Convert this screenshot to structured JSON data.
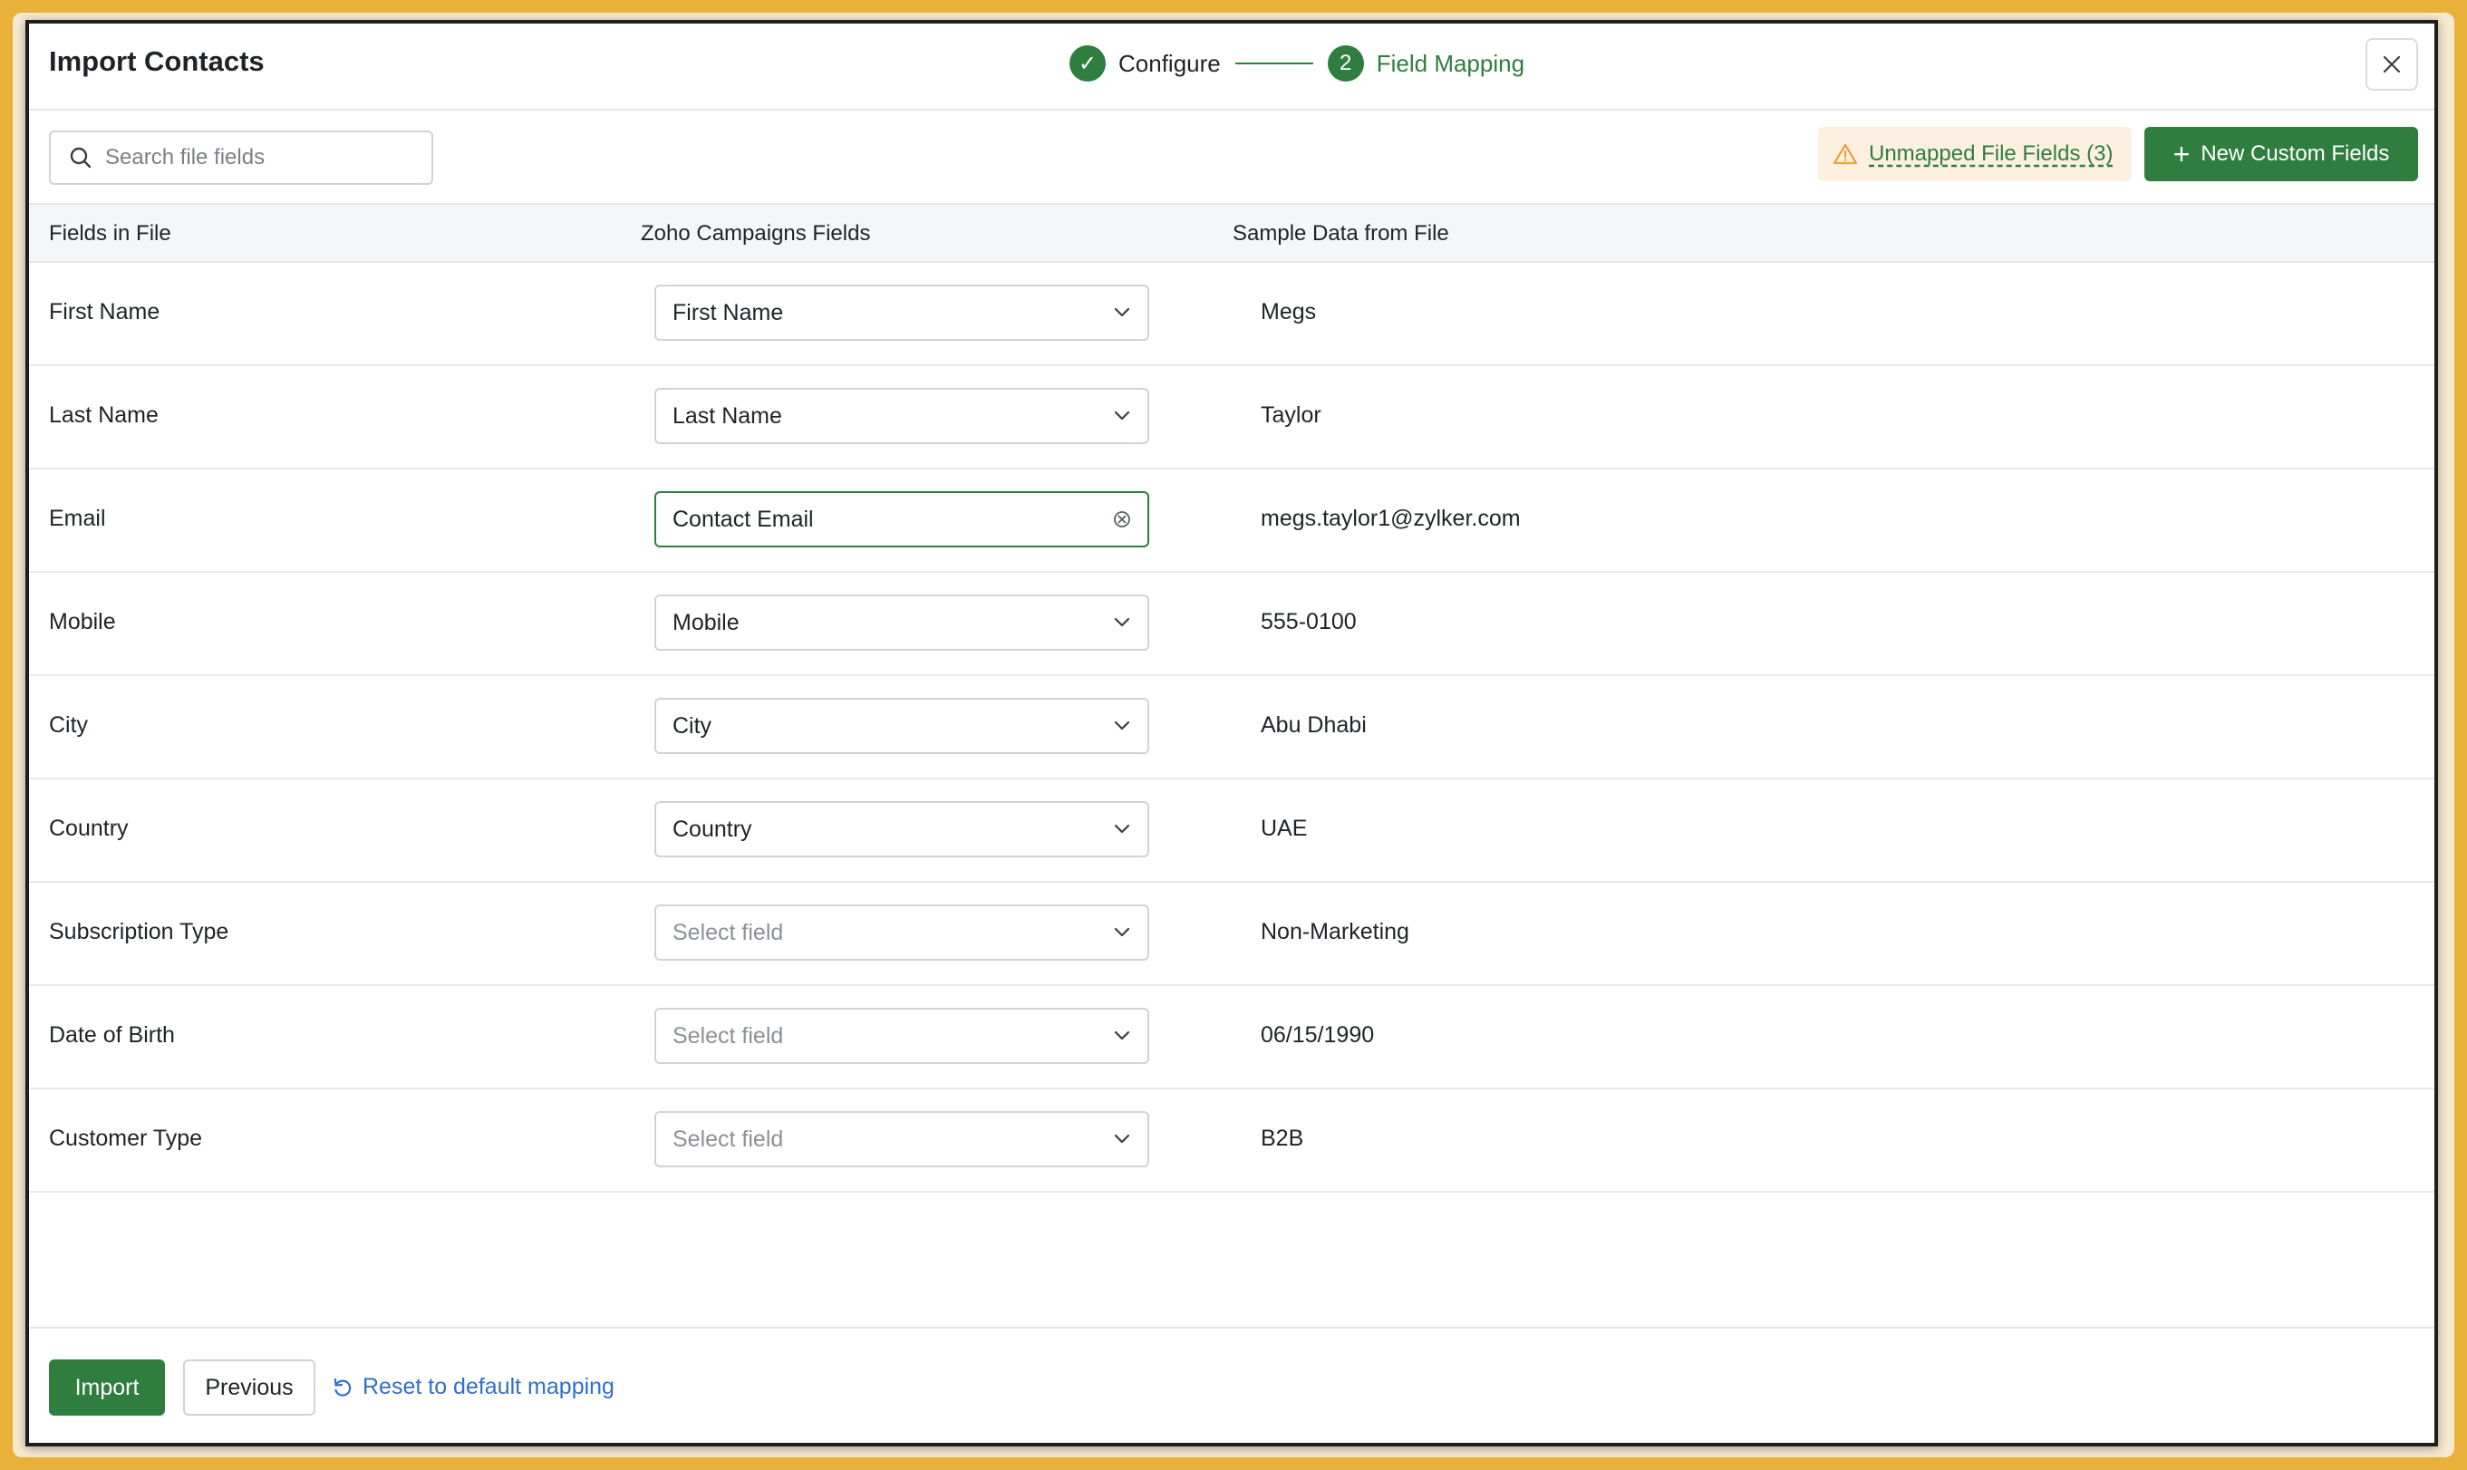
{
  "modal": {
    "title": "Import Contacts",
    "steps": [
      {
        "label": "Configure",
        "status": "done",
        "marker": "✓"
      },
      {
        "label": "Field Mapping",
        "status": "active",
        "marker": "2"
      }
    ]
  },
  "toolbar": {
    "search_placeholder": "Search file fields",
    "unmapped_label": "Unmapped File Fields (3)",
    "new_custom_label": "New Custom Fields"
  },
  "table": {
    "headers": [
      "Fields in File",
      "Zoho Campaigns Fields",
      "Sample Data from File"
    ],
    "rows": [
      {
        "file_field": "First Name",
        "mapped": "First Name",
        "sample": "Megs"
      },
      {
        "file_field": "Last Name",
        "mapped": "Last Name",
        "sample": "Taylor"
      },
      {
        "file_field": "Email",
        "mapped": "Contact Email",
        "sample": "megs.taylor1@zylker.com"
      },
      {
        "file_field": "Mobile",
        "mapped": "Mobile",
        "sample": "555-0100"
      },
      {
        "file_field": "City",
        "mapped": "City",
        "sample": "Abu Dhabi"
      },
      {
        "file_field": "Country",
        "mapped": "Country",
        "sample": "UAE"
      },
      {
        "file_field": "Subscription Type",
        "mapped": "Select field",
        "sample": "Non-Marketing"
      },
      {
        "file_field": "Date of Birth",
        "mapped": "Select field",
        "sample": "06/15/1990"
      },
      {
        "file_field": "Customer Type",
        "mapped": "Select field",
        "sample": "B2B"
      }
    ]
  },
  "footer": {
    "import_label": "Import",
    "previous_label": "Previous",
    "reset_label": "Reset to default mapping"
  },
  "colors": {
    "accent": "#2f7d3f",
    "link": "#2f6fcf",
    "warning_bg": "#fdf0e1",
    "warning_icon": "#e5a43a"
  }
}
